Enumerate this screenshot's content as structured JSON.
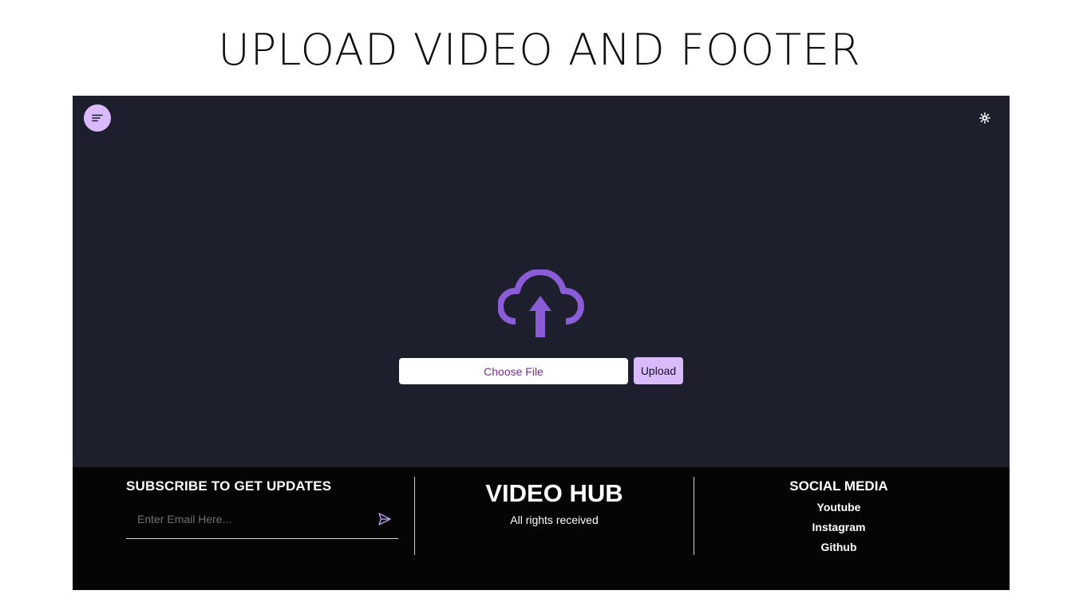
{
  "slide": {
    "title": "UPLOAD VIDEO AND FOOTER"
  },
  "header": {
    "menu_icon": "sort-lines-icon",
    "theme_icon": "sun-gear-icon"
  },
  "upload": {
    "icon": "cloud-upload-icon",
    "choose_file_label": "Choose File",
    "upload_button_label": "Upload"
  },
  "footer": {
    "subscribe": {
      "heading": "SUBSCRIBE TO GET UPDATES",
      "email_placeholder": "Enter Email Here...",
      "send_icon": "send-icon"
    },
    "brand": {
      "name": "VIDEO HUB",
      "rights": "All rights received"
    },
    "social": {
      "heading": "SOCIAL MEDIA",
      "links": [
        "Youtube",
        "Instagram",
        "Github"
      ]
    }
  },
  "colors": {
    "app_background": "#1d1f2d",
    "accent": "#d9bbfb",
    "icon_purple": "#8a5cd6",
    "footer_background": "#050505",
    "choose_file_text": "#7a2b91"
  }
}
